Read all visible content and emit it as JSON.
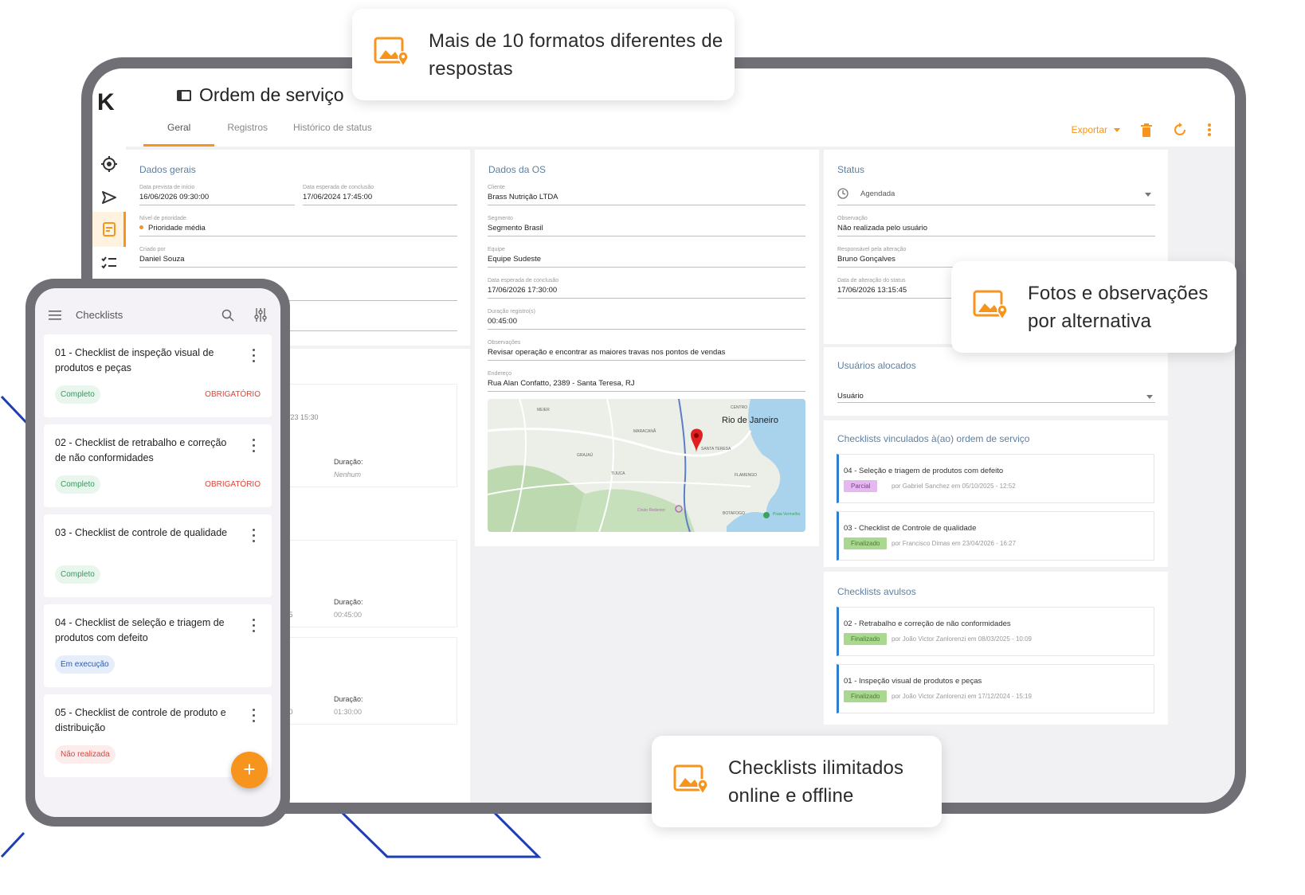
{
  "app": {
    "logo": "K",
    "title": "Ordem de serviço",
    "tabs": [
      {
        "label": "Geral"
      },
      {
        "label": "Registros"
      },
      {
        "label": "Histórico de status"
      }
    ],
    "export_label": "Exportar"
  },
  "dados_gerais": {
    "title": "Dados gerais",
    "inicio_label": "Data prevista de início",
    "inicio_value": "16/06/2026 09:30:00",
    "conclusao_label": "Data esperada de conclusão",
    "conclusao_value": "17/06/2024 17:45:00",
    "prioridade_label": "Nível de prioridade",
    "prioridade_value": "Prioridade média",
    "criado_label": "Criado por",
    "criado_value": "Daniel Souza"
  },
  "registros_peek": {
    "r1_time": "2/23 15:30",
    "r1_dur_label": "Duração:",
    "r1_dur_value": "Nenhum",
    "r2_time": ":45",
    "r2_dur_label": "Duração:",
    "r2_dur_value": "00:45:00",
    "r3_time": ":30",
    "r3_dur_label": "Duração:",
    "r3_dur_value": "01:30:00"
  },
  "dados_os": {
    "title": "Dados da OS",
    "cliente_label": "Cliente",
    "cliente_value": "Brass Nutrição LTDA",
    "segmento_label": "Segmento",
    "segmento_value": "Segmento Brasil",
    "equipe_label": "Equipe",
    "equipe_value": "Equipe Sudeste",
    "conclusao_label": "Data esperada de conclusão",
    "conclusao_value": "17/06/2026 17:30:00",
    "duracao_label": "Duração registro(s)",
    "duracao_value": "00:45:00",
    "obs_label": "Observações",
    "obs_value": "Revisar operação e encontrar as maiores travas nos pontos de vendas",
    "endereco_label": "Endereço",
    "endereco_value": "Rua Alan Confatto, 2389 - Santa Teresa, RJ"
  },
  "map": {
    "city": "Rio de Janeiro",
    "labels": {
      "meier": "MEIER",
      "maracana": "MARACANÃ",
      "grajau": "GRAJAÚ",
      "tijuca": "TIJUCA",
      "centro": "CENTRO",
      "santa_teresa": "SANTA TERESA",
      "flamengo": "FLAMENGO",
      "botafogo": "BOTAFOGO",
      "cristo": "Cristo Redentor",
      "praia": "Praia Vermelha"
    }
  },
  "status": {
    "title": "Status",
    "status_value": "Agendada",
    "obs_label": "Observação",
    "obs_value": "Não realizada pelo usuário",
    "resp_label": "Responsável pela alteração",
    "resp_value": "Bruno Gonçalves",
    "data_label": "Data de alteração do status",
    "data_value": "17/06/2026 13:15:45"
  },
  "usuarios": {
    "title": "Usuários alocados",
    "select_value": "Usuário"
  },
  "vinculados": {
    "title": "Checklists vinculados à(ao) ordem de serviço",
    "items": [
      {
        "title": "04 - Seleção e triagem de produtos com defeito",
        "badge": "Parcial",
        "meta": "por Gabriel Sanchez em 05/10/2025 - 12:52"
      },
      {
        "title": "03 - Checklist de Controle de qualidade",
        "badge": "Finalizado",
        "meta": "por Francisco Dimas em 23/04/2026 - 16:27"
      }
    ]
  },
  "avulsos": {
    "title": "Checklists avulsos",
    "items": [
      {
        "title": "02 - Retrabalho e correção de não conformidades",
        "badge": "Finalizado",
        "meta": "por João Victor Zanlorenzi em 08/03/2025 - 10:09"
      },
      {
        "title": "01 - Inspeção visual de produtos e peças",
        "badge": "Finalizado",
        "meta": "por João Victor Zanlorenzi em 17/12/2024 - 15:19"
      }
    ]
  },
  "phone": {
    "title": "Checklists",
    "fab": "+",
    "items": [
      {
        "name": "01 - Checklist de inspeção visual de produtos e peças",
        "status": "Completo",
        "required": "OBRIGATÓRIO"
      },
      {
        "name": "02 - Checklist de retrabalho e correção de não conformidades",
        "status": "Completo",
        "required": "OBRIGATÓRIO"
      },
      {
        "name": "03 - Checklist de controle de qualidade",
        "status": "Completo",
        "required": ""
      },
      {
        "name": "04 - Checklist de seleção e triagem de produtos com defeito",
        "status": "Em execução",
        "required": ""
      },
      {
        "name": "05 - Checklist de controle de produto e distribuição",
        "status": "Não realizada",
        "required": ""
      }
    ]
  },
  "callouts": {
    "formats": "Mais de 10 formatos diferentes de respostas",
    "photos": "Fotos e observações por alternativa",
    "unlimited": "Checklists ilimitados online e offline"
  },
  "colors": {
    "accent": "#f7941d",
    "card_title": "#5f7f9e",
    "deco_line": "#1e3fb4",
    "frame": "#6f6f75"
  }
}
